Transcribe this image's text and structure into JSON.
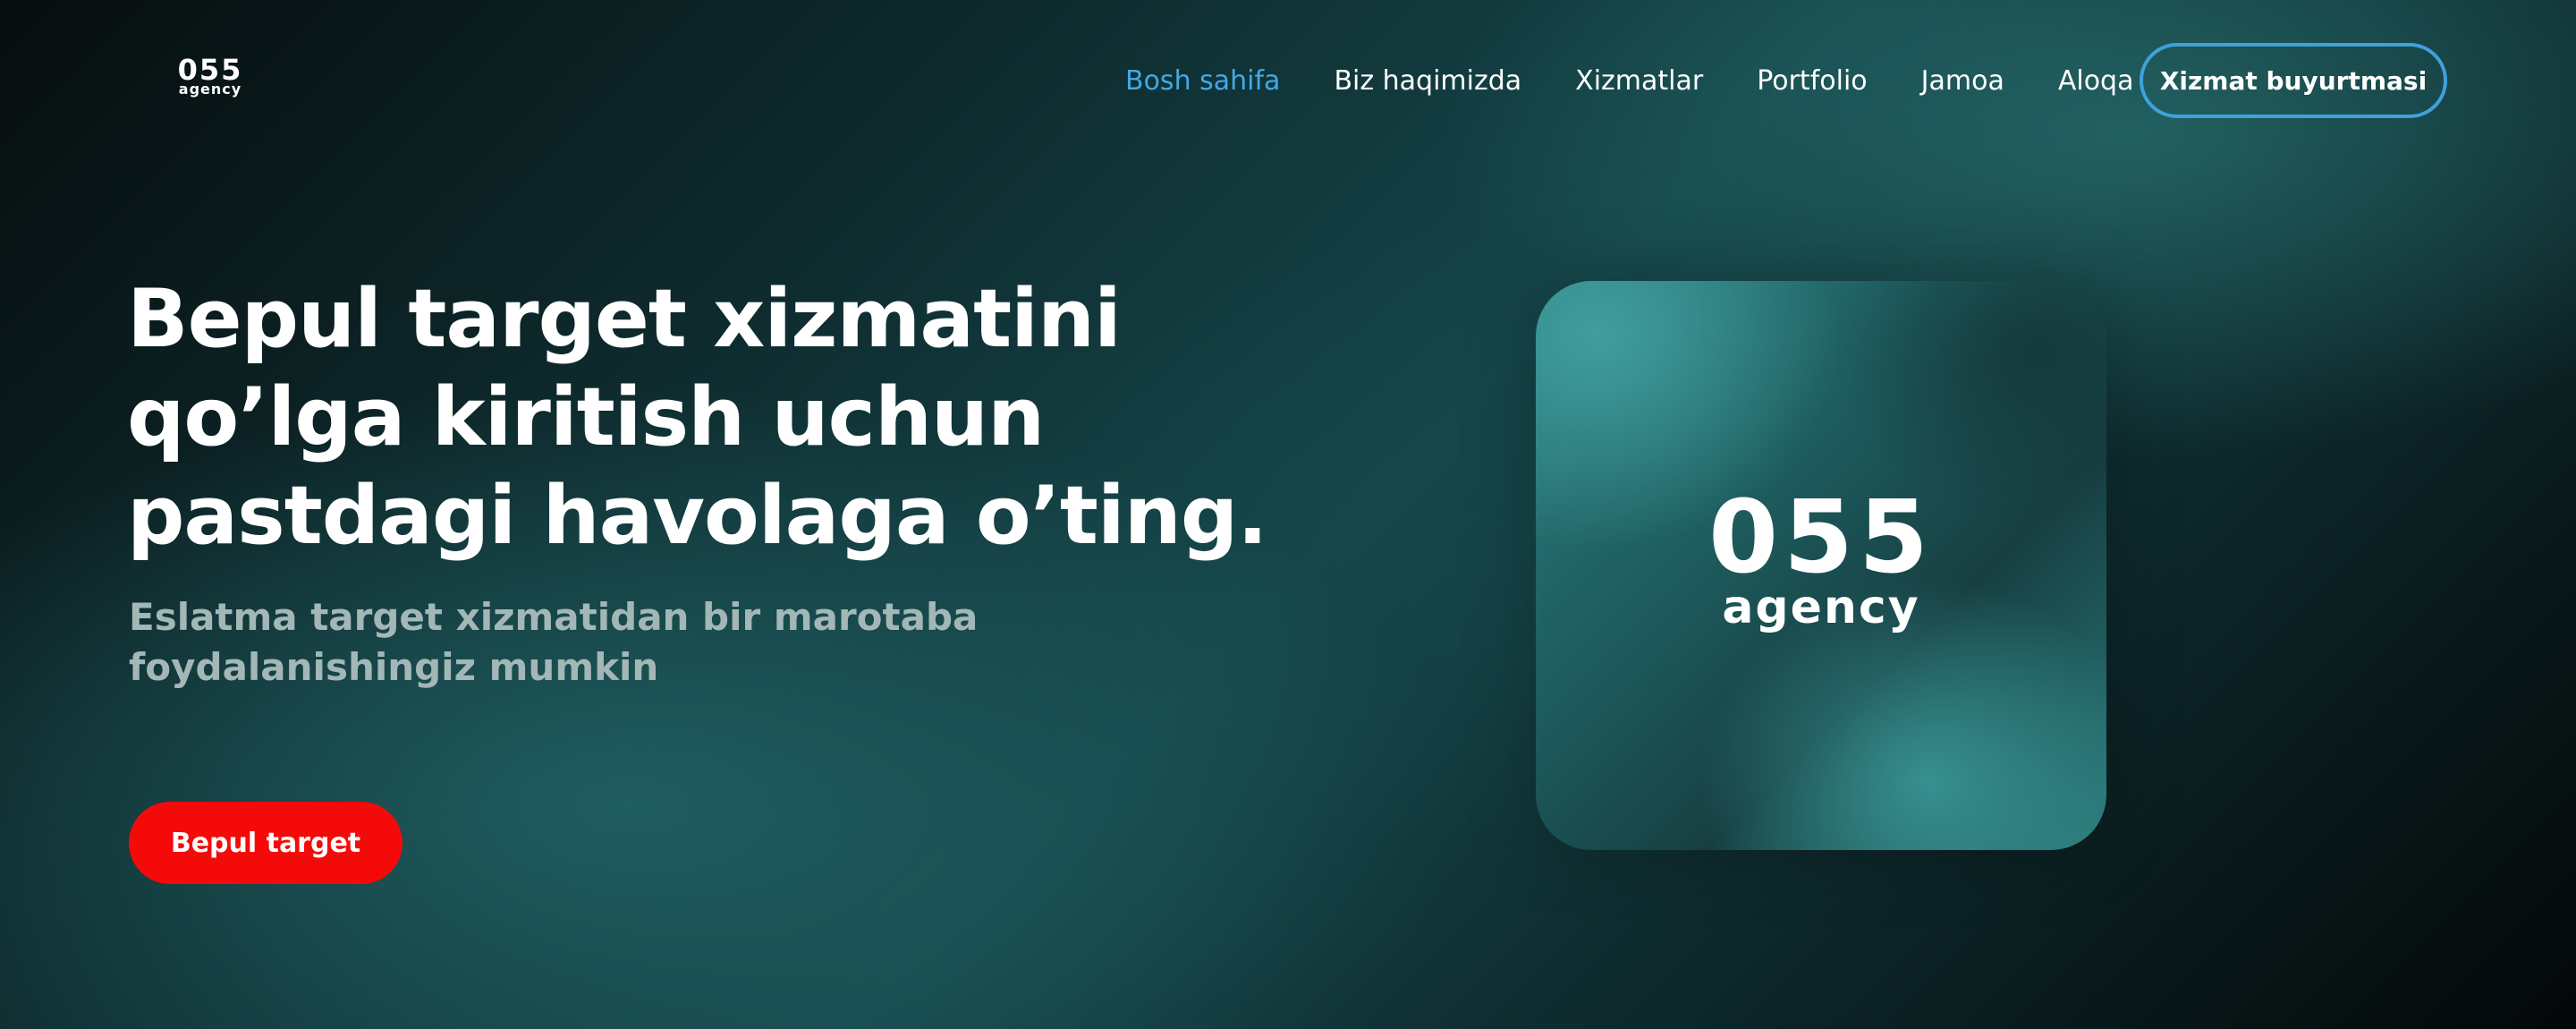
{
  "brand": {
    "logo_number": "055",
    "logo_word": "agency"
  },
  "nav": {
    "items": [
      {
        "label": "Bosh sahifa",
        "active": true
      },
      {
        "label": "Biz haqimizda",
        "active": false
      },
      {
        "label": "Xizmatlar",
        "active": false
      },
      {
        "label": "Portfolio",
        "active": false
      },
      {
        "label": "Jamoa",
        "active": false
      },
      {
        "label": "Aloqa",
        "active": false
      }
    ],
    "cta_label": "Xizmat buyurtmasi"
  },
  "hero": {
    "title_lines": [
      "Bepul target xizmatini",
      "qo’lga kiritish uchun",
      "pastdagi havolaga o’ting."
    ],
    "subtitle": "Eslatma target xizmatidan bir marotaba foydalanishingiz mumkin",
    "button_label": "Bepul target"
  },
  "colors": {
    "active_nav": "#42a9e6",
    "cta_border": "#3fa2da",
    "primary_button": "#f50a0a",
    "subtitle_text": "#a3b7b7"
  }
}
